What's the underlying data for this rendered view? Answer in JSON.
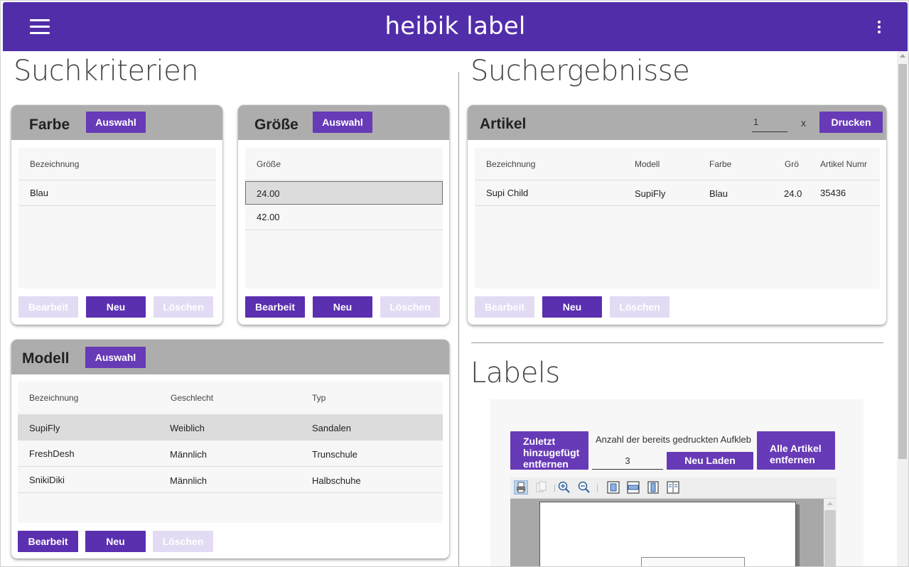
{
  "app": {
    "title": "heibik label"
  },
  "left": {
    "heading": "Suchkriterien"
  },
  "right": {
    "heading": "Suchergebnisse"
  },
  "farbe": {
    "title": "Farbe",
    "auswahl": "Auswahl",
    "columns": [
      "Bezeichnung"
    ],
    "rows": [
      [
        "Blau"
      ]
    ],
    "edit": "Bearbeit",
    "new": "Neu",
    "delete": "Löschen"
  },
  "groesse": {
    "title": "Größe",
    "auswahl": "Auswahl",
    "columns": [
      "Größe"
    ],
    "rows": [
      [
        "24.00"
      ],
      [
        "42.00"
      ]
    ],
    "edit": "Bearbeit",
    "new": "Neu",
    "delete": "Löschen"
  },
  "modell": {
    "title": "Modell",
    "auswahl": "Auswahl",
    "columns": [
      "Bezeichnung",
      "Geschlecht",
      "Typ"
    ],
    "rows": [
      [
        "SupiFly",
        "Weiblich",
        "Sandalen"
      ],
      [
        "FreshDesh",
        "Männlich",
        "Trunschule"
      ],
      [
        "SnikiDiki",
        "Männlich",
        "Halbschuhe"
      ]
    ],
    "edit": "Bearbeit",
    "new": "Neu",
    "delete": "Löschen"
  },
  "artikel": {
    "title": "Artikel",
    "qty": "1",
    "x": "x",
    "print": "Drucken",
    "columns": [
      "Bezeichnung",
      "Modell",
      "Farbe",
      "Grö",
      "Artikel Numr"
    ],
    "rows": [
      [
        "Supi Child",
        "SupiFly",
        "Blau",
        "24.0",
        "35436"
      ]
    ],
    "edit": "Bearbeit",
    "new": "Neu",
    "delete": "Löschen"
  },
  "labels": {
    "heading": "Labels",
    "remove_last": "Zuletzt hinzugefügt entfernen",
    "printed_count_label": "Anzahl der bereits gedruckten Aufkleb",
    "printed_count": "3",
    "reload": "Neu Laden",
    "remove_all": "Alle Artikel entfernen",
    "toolbar_icons": [
      "print-icon",
      "copy-icon",
      "zoom-in-icon",
      "zoom-out-icon",
      "fit-page-icon",
      "fit-width-icon",
      "single-page-icon",
      "two-page-icon"
    ]
  }
}
